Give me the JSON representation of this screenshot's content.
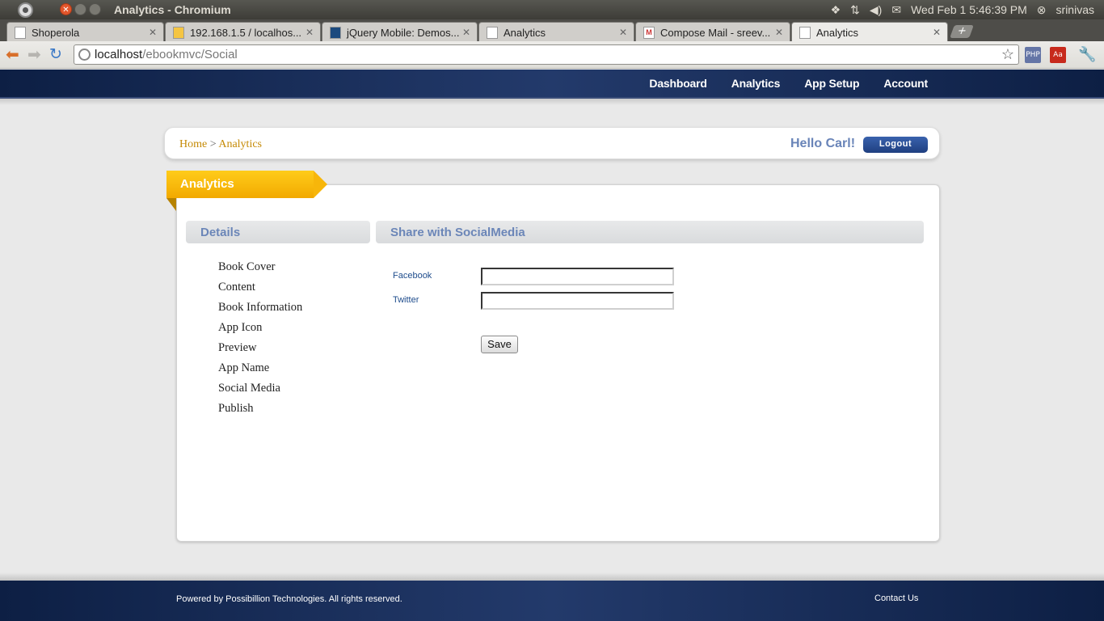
{
  "os": {
    "window_title": "Analytics - Chromium",
    "clock": "Wed Feb  1  5:46:39 PM",
    "user": "srinivas"
  },
  "tabs": [
    {
      "label": "Shoperola",
      "icon": "page-icon"
    },
    {
      "label": "192.168.1.5 / localhos...",
      "icon": "pma-icon"
    },
    {
      "label": "jQuery Mobile: Demos...",
      "icon": "jquery-icon"
    },
    {
      "label": "Analytics",
      "icon": "page-icon"
    },
    {
      "label": "Compose Mail - sreev...",
      "icon": "gmail-icon"
    },
    {
      "label": "Analytics",
      "icon": "page-icon"
    }
  ],
  "address": {
    "host": "localhost",
    "path": "/ebookmvc/Social"
  },
  "extensions": {
    "php": "PHP",
    "aa": "Aa"
  },
  "site_nav": [
    "Dashboard",
    "Analytics",
    "App Setup",
    "Account"
  ],
  "breadcrumb": {
    "home": "Home",
    "separator": " > ",
    "current": "Analytics"
  },
  "greeting": "Hello Carl!",
  "logout_label": "Logout",
  "ribbon_title": "Analytics",
  "details": {
    "heading": "Details",
    "items": [
      "Book Cover",
      "Content",
      "Book Information",
      "App Icon",
      "Preview",
      "App Name",
      "Social Media",
      "Publish"
    ]
  },
  "share": {
    "heading": "Share with SocialMedia",
    "facebook_label": "Facebook",
    "facebook_value": "",
    "twitter_label": "Twitter",
    "twitter_value": "",
    "save_label": "Save"
  },
  "footer": {
    "copyright": "Powered by Possibillion Technologies. All rights reserved.",
    "contact": "Contact Us"
  }
}
